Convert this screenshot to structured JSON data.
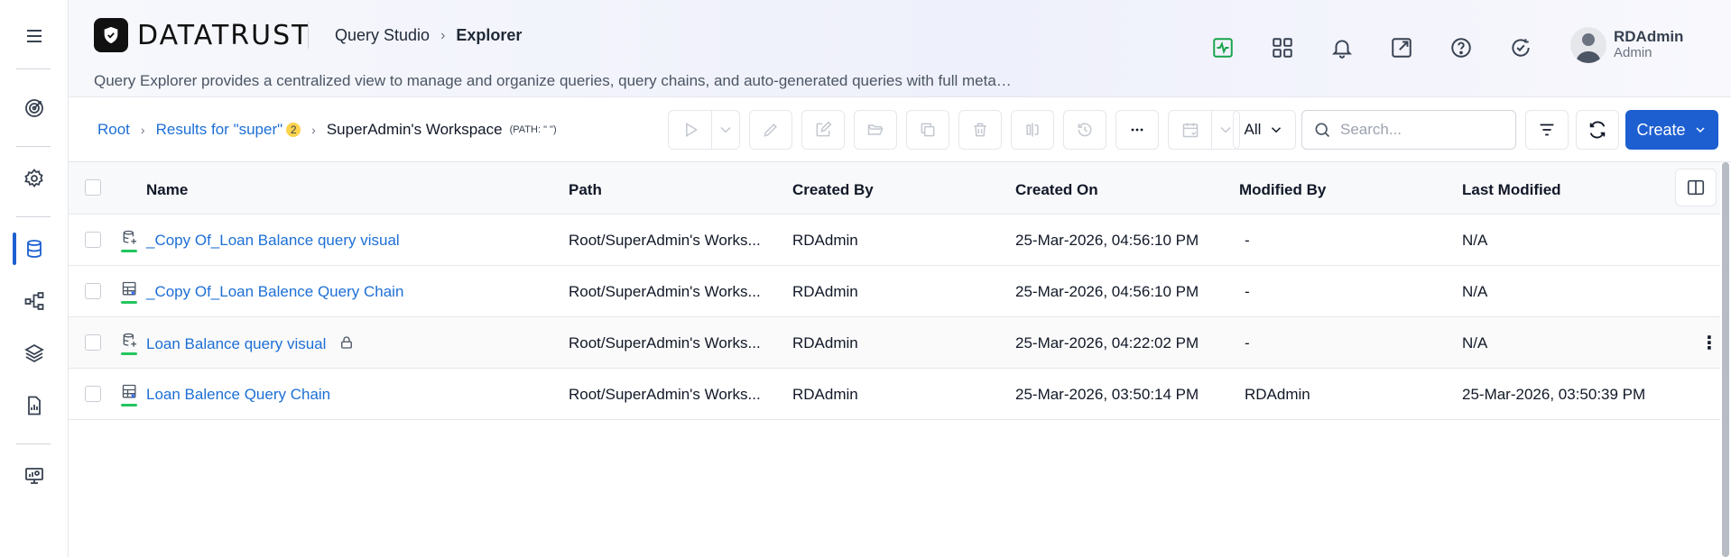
{
  "app": {
    "logo_text": "DATATRUST"
  },
  "header": {
    "breadcrumb": [
      "Query Studio",
      "Explorer"
    ],
    "description": "Query Explorer provides a centralized view to manage and organize queries, query chains, and auto-generated queries with full meta…"
  },
  "user": {
    "name": "RDAdmin",
    "role": "Admin"
  },
  "toolbar": {
    "breadcrumb": {
      "root": "Root",
      "results": "Results for \"super\"",
      "results_count": "2",
      "current": "SuperAdmin's Workspace",
      "path": "(PATH: \" \")"
    },
    "filter_select": "All",
    "search_placeholder": "Search...",
    "create_label": "Create"
  },
  "table": {
    "columns": [
      "Name",
      "Path",
      "Created By",
      "Created On",
      "Modified By",
      "Last Modified"
    ],
    "rows": [
      {
        "name": "_Copy Of_Loan Balance query visual",
        "type": "query-visual",
        "locked": false,
        "path": "Root/SuperAdmin's Works...",
        "created_by": "RDAdmin",
        "created_on": "25-Mar-2026, 04:56:10 PM",
        "modified_by": "-",
        "last_modified": "N/A"
      },
      {
        "name": "_Copy Of_Loan Balence Query Chain",
        "type": "query-chain",
        "locked": false,
        "path": "Root/SuperAdmin's Works...",
        "created_by": "RDAdmin",
        "created_on": "25-Mar-2026, 04:56:10 PM",
        "modified_by": "-",
        "last_modified": "N/A"
      },
      {
        "name": "Loan Balance query visual",
        "type": "query-visual",
        "locked": true,
        "path": "Root/SuperAdmin's Works...",
        "created_by": "RDAdmin",
        "created_on": "25-Mar-2026, 04:22:02 PM",
        "modified_by": "-",
        "last_modified": "N/A"
      },
      {
        "name": "Loan Balence Query Chain",
        "type": "query-chain",
        "locked": false,
        "path": "Root/SuperAdmin's Works...",
        "created_by": "RDAdmin",
        "created_on": "25-Mar-2026, 03:50:14 PM",
        "modified_by": "RDAdmin",
        "last_modified": "25-Mar-2026, 03:50:39 PM"
      }
    ]
  },
  "colors": {
    "accent": "#1d5fd1",
    "link": "#1d6fd6",
    "status_green": "#22c55e",
    "badge": "#fcd34d"
  }
}
